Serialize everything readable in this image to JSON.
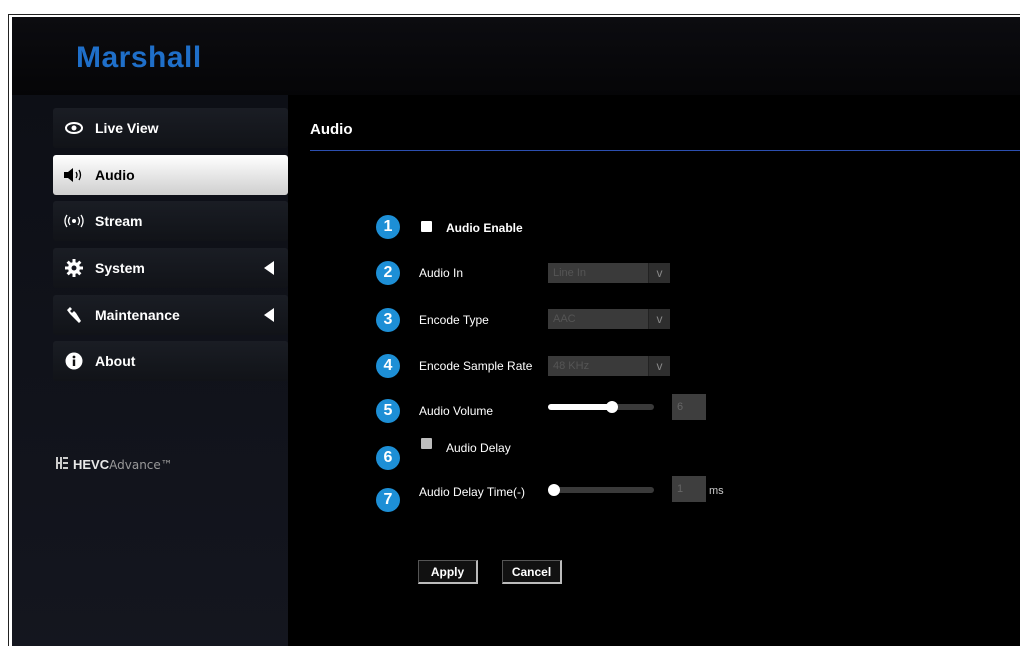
{
  "brand": {
    "logo": "Marshall",
    "hevc_bold": "HEVC",
    "hevc_light": "Advance™",
    "hevc_mark": "HE VC"
  },
  "sidebar": {
    "items": [
      {
        "label": "Live View",
        "icon": "eye-icon"
      },
      {
        "label": "Audio",
        "icon": "speaker-icon",
        "active": true
      },
      {
        "label": "Stream",
        "icon": "broadcast-icon"
      },
      {
        "label": "System",
        "icon": "gear-icon",
        "expandable": true
      },
      {
        "label": "Maintenance",
        "icon": "wrench-icon",
        "expandable": true
      },
      {
        "label": "About",
        "icon": "info-icon"
      }
    ]
  },
  "page": {
    "title": "Audio"
  },
  "form": {
    "badges": [
      "1",
      "2",
      "3",
      "4",
      "5",
      "6",
      "7"
    ],
    "audio_enable": {
      "label": "Audio Enable",
      "checked": false
    },
    "audio_in": {
      "label": "Audio In",
      "value": "Line In"
    },
    "encode_type": {
      "label": "Encode Type",
      "value": "AAC"
    },
    "encode_sample_rate": {
      "label": "Encode Sample Rate",
      "value": "48 KHz"
    },
    "audio_volume": {
      "label": "Audio Volume",
      "value": "6",
      "level": 0.6
    },
    "audio_delay": {
      "label": "Audio Delay",
      "checked": false
    },
    "audio_delay_time": {
      "label": "Audio Delay Time(-)",
      "value": "1",
      "unit": "ms",
      "level": 0.0
    },
    "apply_label": "Apply",
    "cancel_label": "Cancel"
  },
  "colors": {
    "accent": "#1d8fd6",
    "logo": "#1f6fc9",
    "divider": "#2c4fb0"
  }
}
